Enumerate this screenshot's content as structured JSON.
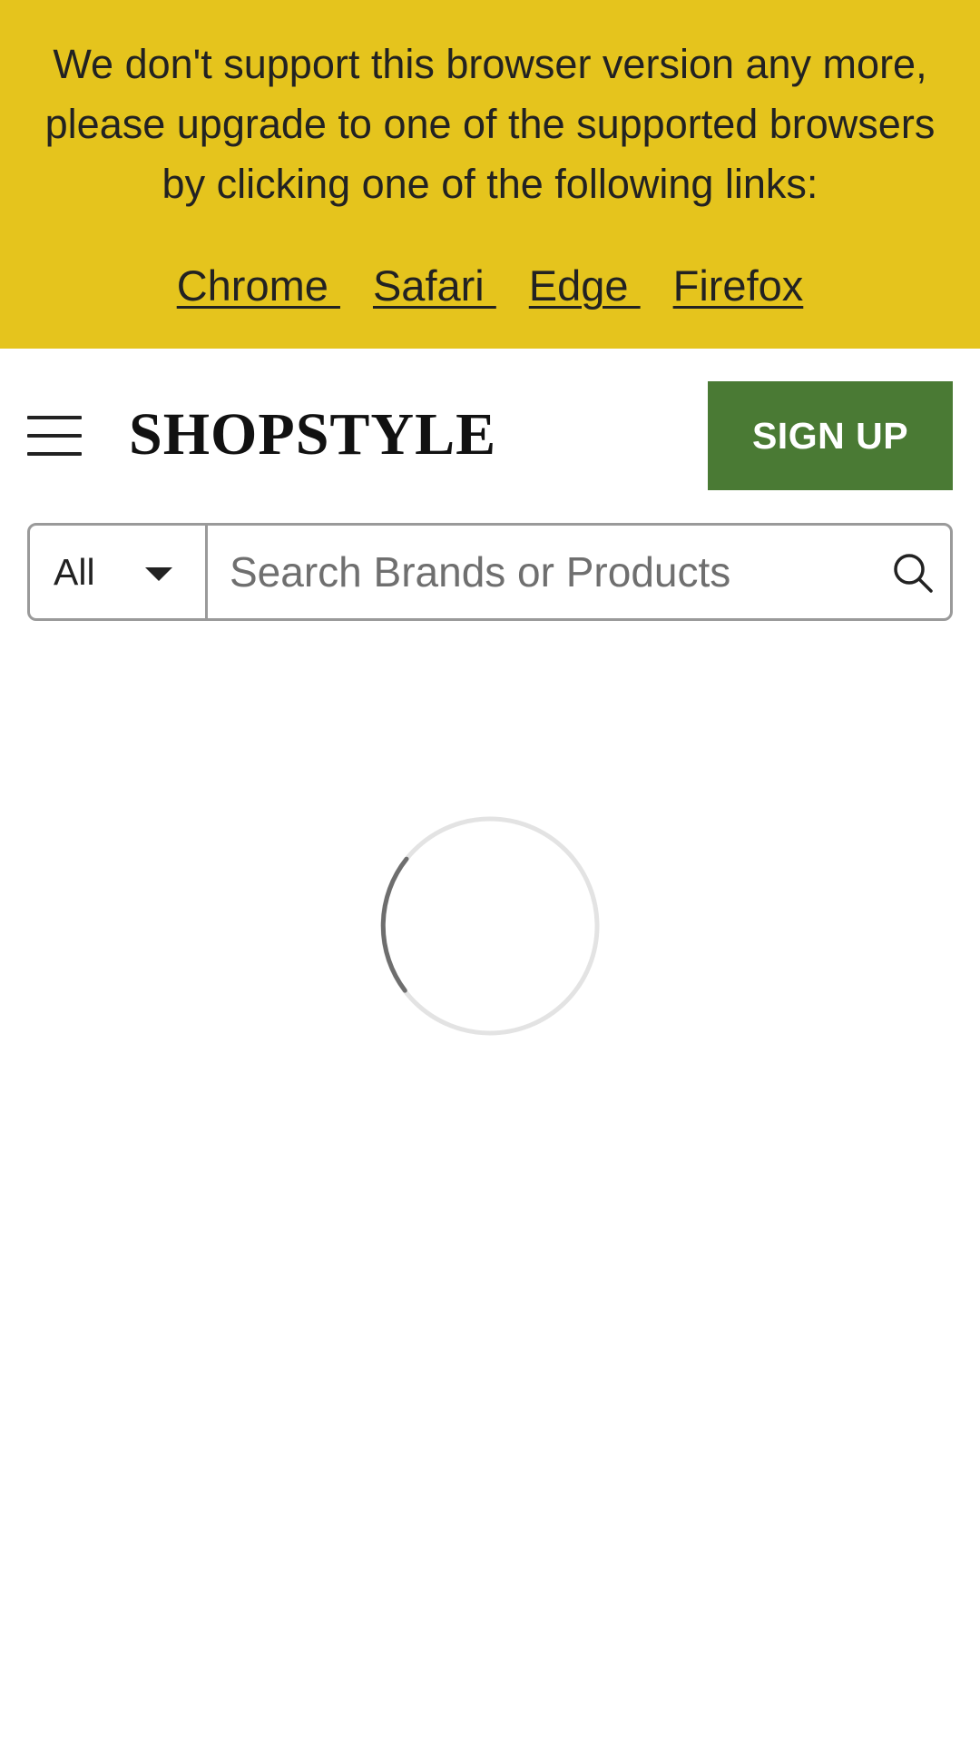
{
  "banner": {
    "message": "We don't support this browser version any more, please upgrade to one of the supported browsers by clicking one of the following links:",
    "links": [
      {
        "label": "Chrome "
      },
      {
        "label": "Safari "
      },
      {
        "label": "Edge "
      },
      {
        "label": "Firefox"
      }
    ],
    "background_color": "#e5c41d"
  },
  "header": {
    "menu_icon": "hamburger-menu-icon",
    "logo_text": "SHOPSTYLE",
    "signup_label": "SIGN UP",
    "signup_color": "#4a7a34"
  },
  "search": {
    "category_value": "All",
    "placeholder": "Search Brands or Products",
    "value": "",
    "search_icon": "magnifier-icon"
  },
  "main": {
    "loading_icon": "spinner-icon"
  }
}
